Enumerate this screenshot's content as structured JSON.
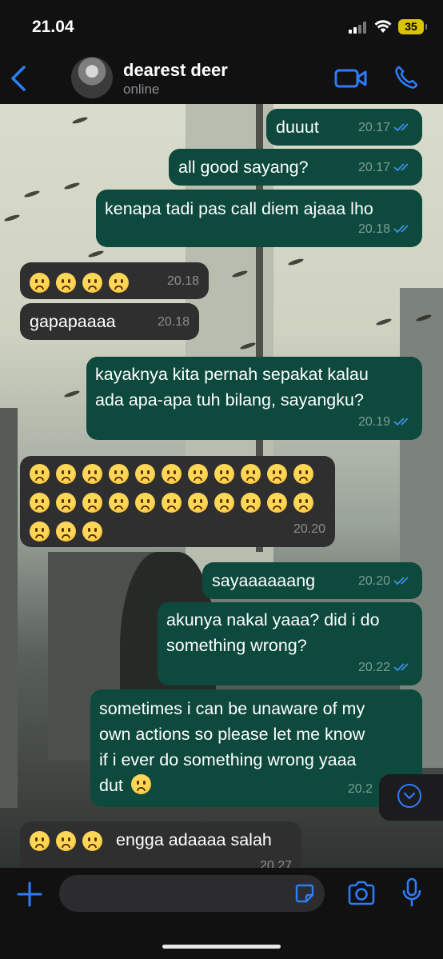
{
  "status": {
    "time": "21.04",
    "battery": "35"
  },
  "header": {
    "name": "dearest deer",
    "presence": "online"
  },
  "messages": [
    {
      "dir": "out",
      "text": "duuut",
      "time": "20.17",
      "read": true
    },
    {
      "dir": "out",
      "text": "all good sayang?",
      "time": "20.17",
      "read": true
    },
    {
      "dir": "out",
      "text": "kenapa tadi pas call diem ajaaa lho",
      "time": "20.18",
      "read": true
    },
    {
      "dir": "in",
      "emoji": "frowning-face x4",
      "time": "20.18"
    },
    {
      "dir": "in",
      "text": "gapapaaaa",
      "time": "20.18"
    },
    {
      "dir": "out",
      "line1": "kayaknya kita pernah sepakat kalau",
      "line2": "ada apa-apa tuh bilang, sayangku?",
      "time": "20.19",
      "read": true
    },
    {
      "dir": "in",
      "emoji": "frowning-face x25",
      "time": "20.20"
    },
    {
      "dir": "out",
      "text": "sayaaaaaang",
      "time": "20.20",
      "read": true
    },
    {
      "dir": "out",
      "line1": "akunya nakal yaaa? did i do",
      "line2": "something wrong?",
      "time": "20.22",
      "read": true
    },
    {
      "dir": "out",
      "line1": "sometimes i can be unaware of my",
      "line2": "own actions so please let me know",
      "line3": "if i ever do something wrong yaaa",
      "line4": "dut",
      "time": "20.2"
    },
    {
      "dir": "in",
      "text": "engga adaaaa salah",
      "time": "20.27"
    }
  ],
  "colors": {
    "outgoing": "#0d4a3d",
    "incoming": "#2f2f2f",
    "accent": "#2e7cf6",
    "read_ticks": "#3b8ff0"
  },
  "icons": {
    "back": "chevron-left-icon",
    "video": "video-camera-icon",
    "call": "phone-icon",
    "plus": "plus-icon",
    "sticker": "sticker-icon",
    "camera": "camera-icon",
    "mic": "microphone-icon",
    "scroll": "chevron-down-icon"
  }
}
